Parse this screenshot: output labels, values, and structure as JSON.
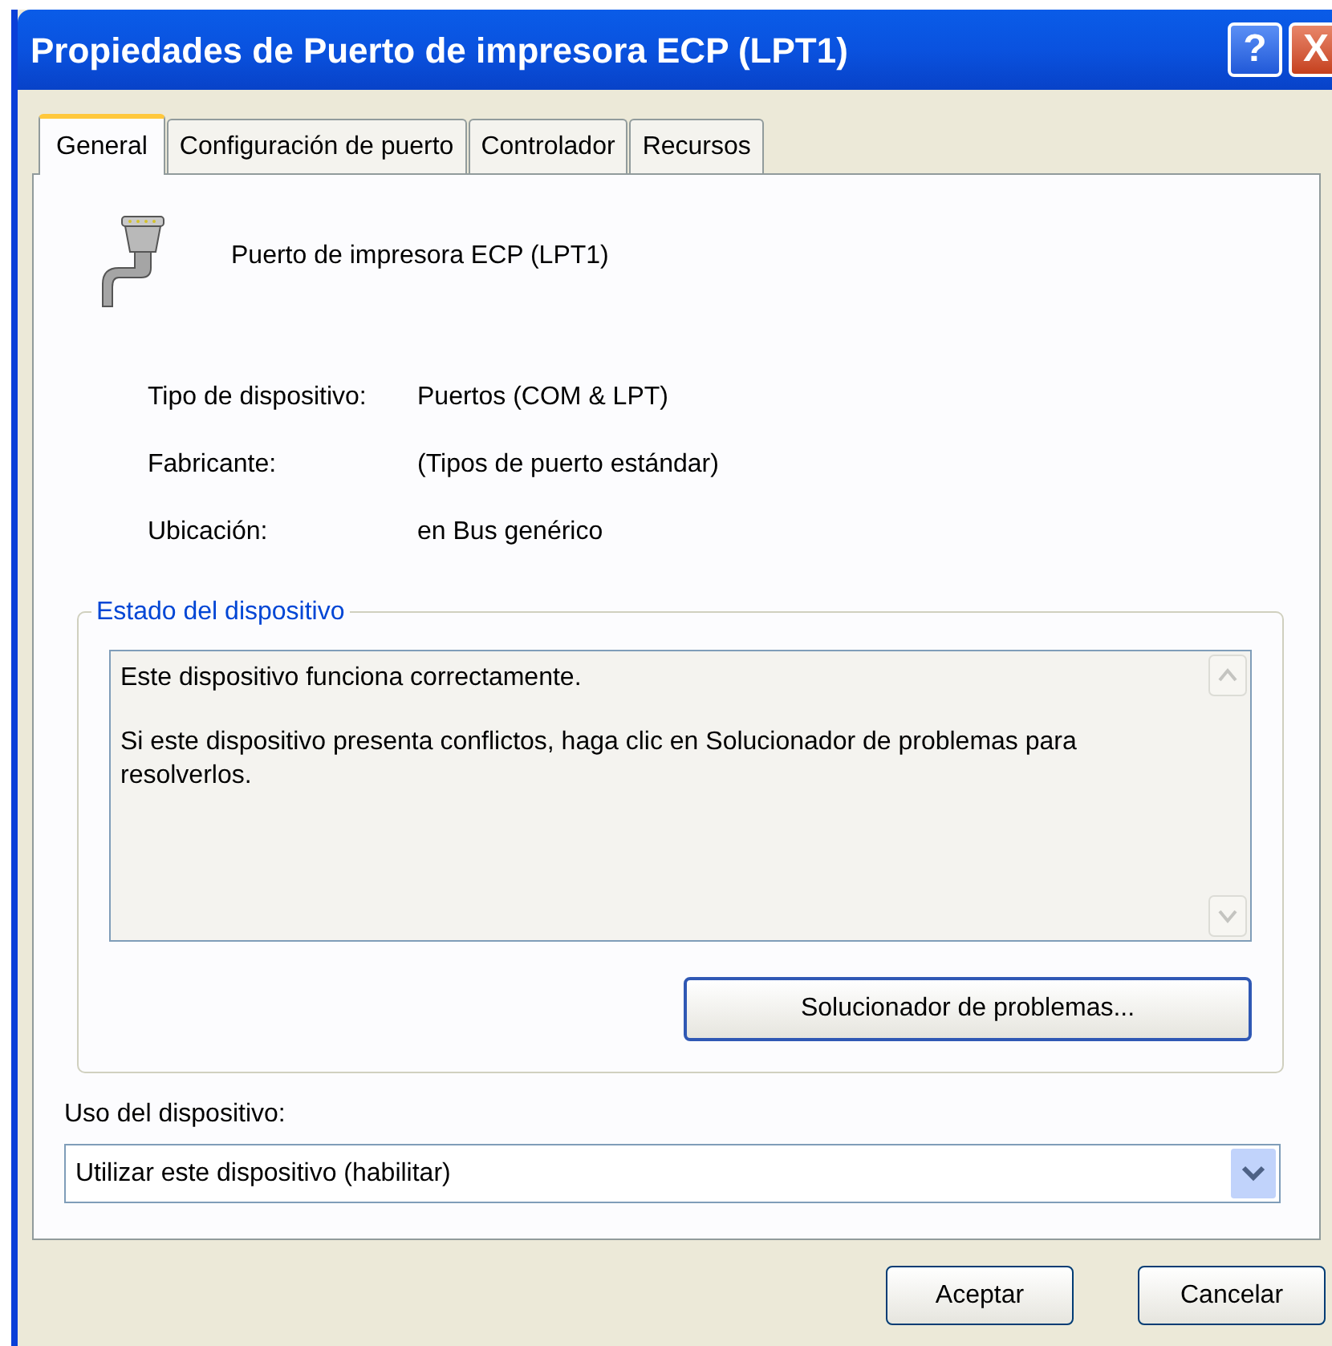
{
  "window": {
    "title": "Propiedades de Puerto de impresora ECP (LPT1)"
  },
  "title_buttons": [
    {
      "kind": "help",
      "label": "?"
    },
    {
      "kind": "close",
      "label": "X"
    }
  ],
  "tabs": [
    {
      "label": "General",
      "selected": true
    },
    {
      "label": "Configuración de puerto",
      "selected": false
    },
    {
      "label": "Controlador",
      "selected": false
    },
    {
      "label": "Recursos",
      "selected": false
    }
  ],
  "device_name": "Puerto de impresora ECP (LPT1)",
  "properties": [
    {
      "label": "Tipo de dispositivo:",
      "value": "Puertos (COM & LPT)"
    },
    {
      "label": "Fabricante:",
      "value": "(Tipos de puerto estándar)"
    },
    {
      "label": "Ubicación:",
      "value": "en Bus genérico"
    }
  ],
  "status_group": {
    "title": "Estado del dispositivo",
    "paragraphs": [
      "Este dispositivo funciona correctamente.",
      "Si este dispositivo presenta conflictos, haga clic en Solucionador de problemas para resolverlos."
    ],
    "button": "Solucionador de problemas..."
  },
  "usage": {
    "label": "Uso del dispositivo:",
    "value": "Utilizar este dispositivo (habilitar)"
  },
  "buttons": [
    "Aceptar",
    "Cancelar"
  ]
}
